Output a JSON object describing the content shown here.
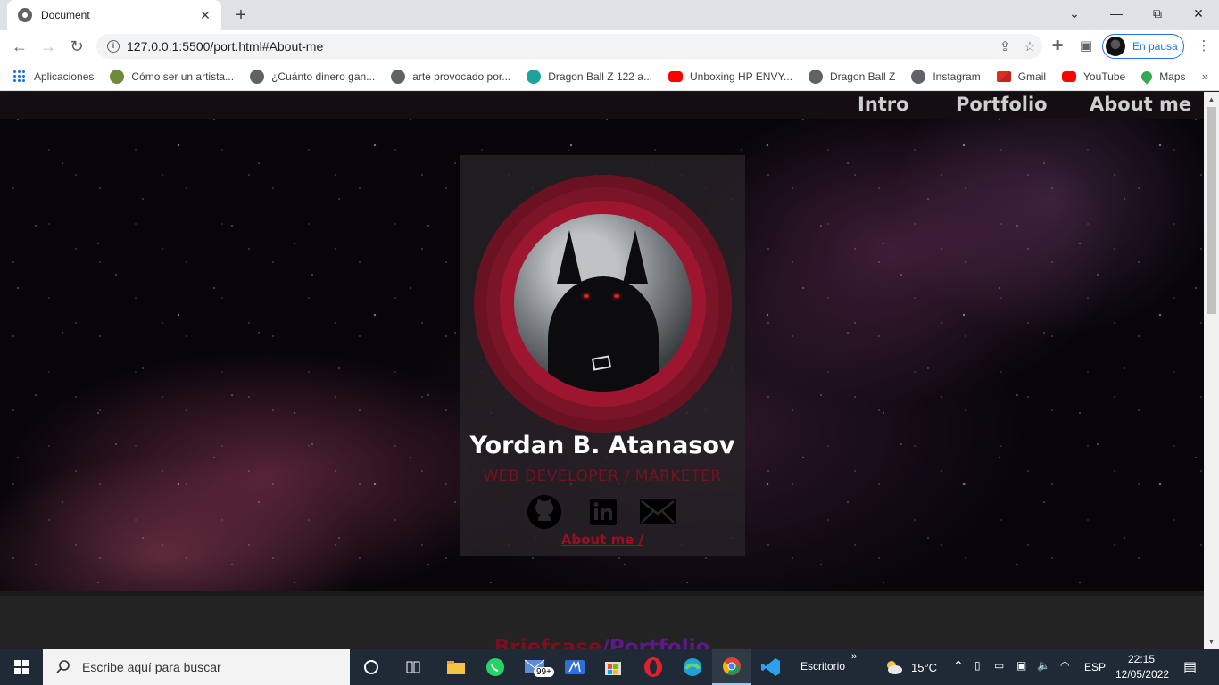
{
  "browser": {
    "tab": {
      "title": "Document",
      "close_glyph": "✕"
    },
    "new_tab_glyph": "+",
    "window_controls": {
      "minimize": "—",
      "restore": "⧉",
      "close": "✕",
      "tabs_menu": "⌄"
    },
    "url": "127.0.0.1:5500/port.html#About-me",
    "profile_label": "En pausa",
    "bookmarks": [
      {
        "label": "Aplicaciones",
        "icon": "apps-grid-icon",
        "color": "#1a73e8"
      },
      {
        "label": "Cómo ser un artista...",
        "icon": "wiki-icon",
        "color": "#6d8a3b"
      },
      {
        "label": "¿Cuánto dinero gan...",
        "icon": "globe-icon",
        "color": "#5f6368"
      },
      {
        "label": "arte provocado por...",
        "icon": "globe-icon",
        "color": "#5f6368"
      },
      {
        "label": "Dragon Ball Z 122 a...",
        "icon": "target-icon",
        "color": "#1ba39c"
      },
      {
        "label": "Unboxing HP ENVY...",
        "icon": "youtube-icon",
        "color": "#ff0000"
      },
      {
        "label": "Dragon Ball Z",
        "icon": "globe-icon",
        "color": "#5f6368"
      },
      {
        "label": "Instagram",
        "icon": "globe-icon",
        "color": "#5f6368"
      },
      {
        "label": "Gmail",
        "icon": "gmail-icon",
        "color": "#d93025"
      },
      {
        "label": "YouTube",
        "icon": "youtube-icon",
        "color": "#ff0000"
      },
      {
        "label": "Maps",
        "icon": "maps-pin-icon",
        "color": "#34a853"
      }
    ],
    "bookmarks_more": "»"
  },
  "page": {
    "nav": [
      "Intro",
      "Portfolio",
      "About me"
    ],
    "profile": {
      "name": "Yordan B. Atanasov",
      "role": "WEB DEVELOPER / MARKETER",
      "link": "About me /",
      "social": [
        "github-icon",
        "linkedin-icon",
        "mail-icon"
      ]
    },
    "section_heading": {
      "part1": "Briefcase",
      "part2": "/Portfolio"
    },
    "colors": {
      "accent_red": "#9e1530",
      "dark_red": "#7a0f1f",
      "purple": "#5b1a8c"
    }
  },
  "taskbar": {
    "search_placeholder": "Escribe aquí para buscar",
    "mail_badge": "99+",
    "desktop_label": "Escritorio",
    "desktop_chevron": "»",
    "weather": "15°C",
    "language": "ESP",
    "time": "22:15",
    "date": "12/05/2022"
  }
}
